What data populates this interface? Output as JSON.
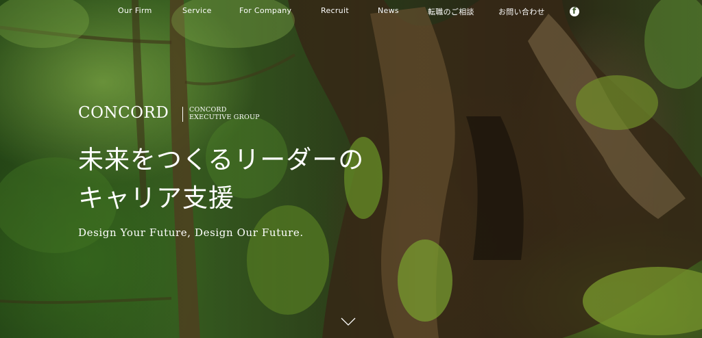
{
  "nav": {
    "items": [
      {
        "label": "Our Firm"
      },
      {
        "label": "Service"
      },
      {
        "label": "For Company"
      },
      {
        "label": "Recruit"
      },
      {
        "label": "News"
      },
      {
        "label": "転職のご相談"
      },
      {
        "label": "お問い合わせ"
      }
    ],
    "facebook_icon": "facebook-icon"
  },
  "logo": {
    "main": "CONCORD",
    "sub_line1": "CONCORD",
    "sub_line2": "EXECUTIVE GROUP"
  },
  "hero": {
    "headline_line1": "未来をつくるリーダーの",
    "headline_line2": "キャリア支援",
    "tagline": "Design Your Future, Design Our Future.",
    "scroll_icon": "chevron-down-icon"
  },
  "colors": {
    "text": "#ffffff",
    "forest_green": "#3e6b24",
    "trunk_brown": "#4b3a1e",
    "moss": "#6f9a2a"
  }
}
